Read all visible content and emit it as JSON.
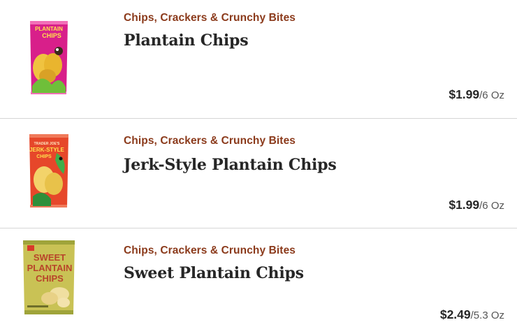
{
  "products": [
    {
      "category": "Chips, Crackers & Crunchy Bites",
      "title": "Plantain Chips",
      "price": "$1.99",
      "unit": "/6 Oz",
      "image_icon": "plantain-chips-bag-icon",
      "bag_color": "#d81f8a"
    },
    {
      "category": "Chips, Crackers & Crunchy Bites",
      "title": "Jerk-Style Plantain Chips",
      "price": "$1.99",
      "unit": "/6 Oz",
      "image_icon": "jerk-style-plantain-chips-bag-icon",
      "bag_color": "#e6472a"
    },
    {
      "category": "Chips, Crackers & Crunchy Bites",
      "title": "Sweet Plantain Chips",
      "price": "$2.49",
      "unit": "/5.3 Oz",
      "image_icon": "sweet-plantain-chips-bag-icon",
      "bag_color": "#c9c255"
    }
  ]
}
